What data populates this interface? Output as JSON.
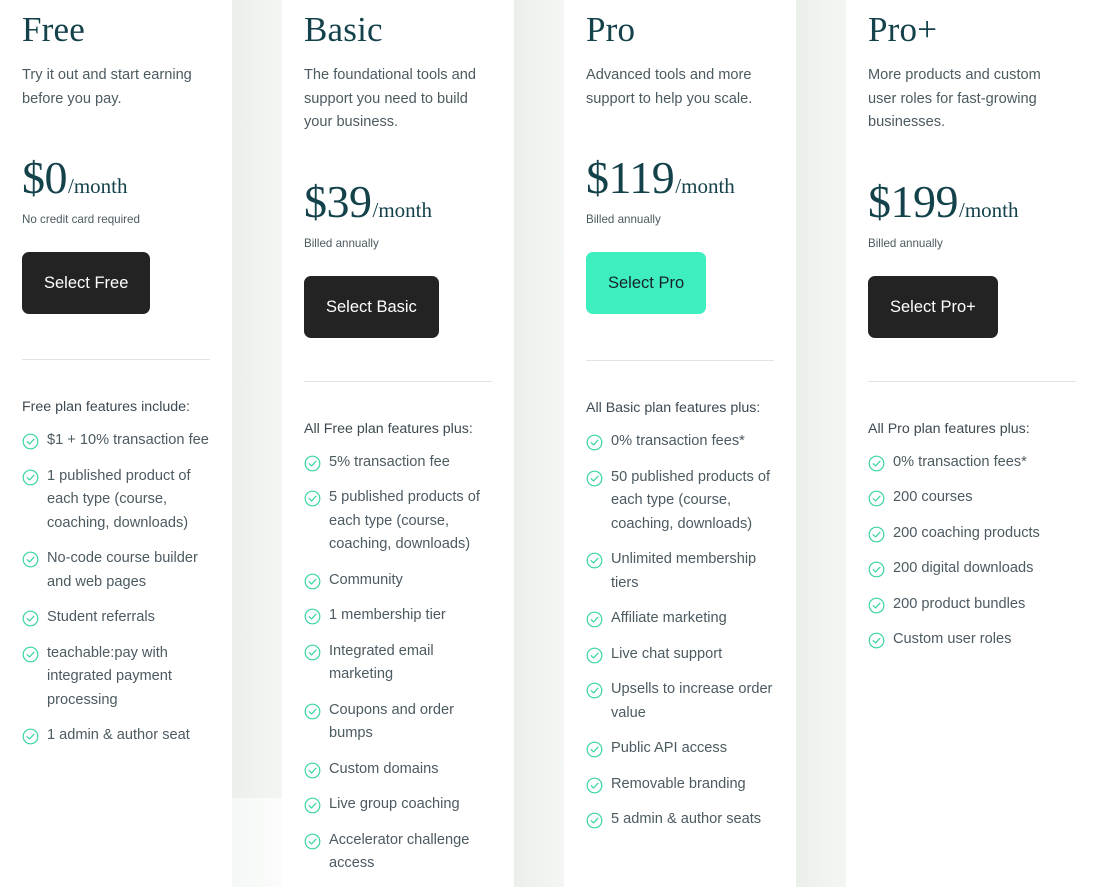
{
  "theme": {
    "accent": "#3eeebd",
    "button_dark": "#232323",
    "check_color": "#3ad3a4",
    "heading_color": "#14424a",
    "body_color": "#4c5a61",
    "gap_color": "#eff3ee"
  },
  "plans": [
    {
      "id": "free",
      "name": "Free",
      "description": "Try it out and start earning before you pay.",
      "price": "$0",
      "period": "/month",
      "price_note": "No credit card required",
      "button_label": "Select Free",
      "button_style": "dark",
      "features_title": "Free plan features include:",
      "features": [
        "$1 + 10% transaction fee",
        "1 published product of each type (course, coaching, downloads)",
        "No-code course builder and web pages",
        "Student referrals",
        "teachable:pay with integrated payment processing",
        "1 admin & author seat"
      ]
    },
    {
      "id": "basic",
      "name": "Basic",
      "description": "The foundational tools and support you need to build your business.",
      "price": "$39",
      "period": "/month",
      "price_note": "Billed annually",
      "button_label": "Select Basic",
      "button_style": "dark",
      "features_title": "All Free plan features plus:",
      "features": [
        "5% transaction fee",
        "5 published products of each type (course, coaching, downloads)",
        "Community",
        "1 membership tier",
        "Integrated email marketing",
        "Coupons and order bumps",
        "Custom domains",
        "Live group coaching",
        "Accelerator challenge access"
      ]
    },
    {
      "id": "pro",
      "name": "Pro",
      "description": "Advanced tools and more support to help you scale.",
      "price": "$119",
      "period": "/month",
      "price_note": "Billed annually",
      "button_label": "Select Pro",
      "button_style": "accent",
      "features_title": "All Basic plan features plus:",
      "features": [
        "0% transaction fees*",
        "50 published products of each type (course, coaching, downloads)",
        "Unlimited membership tiers",
        "Affiliate marketing",
        "Live chat support",
        "Upsells to increase order value",
        "Public API access",
        "Removable branding",
        "5 admin & author seats"
      ]
    },
    {
      "id": "proplus",
      "name": "Pro+",
      "description": "More products and custom user roles for fast-growing businesses.",
      "price": "$199",
      "period": "/month",
      "price_note": "Billed annually",
      "button_label": "Select Pro+",
      "button_style": "dark",
      "features_title": "All Pro plan features plus:",
      "features": [
        "0% transaction fees*",
        "200 courses",
        "200 coaching products",
        "200 digital downloads",
        "200 product bundles",
        "Custom user roles"
      ]
    }
  ]
}
